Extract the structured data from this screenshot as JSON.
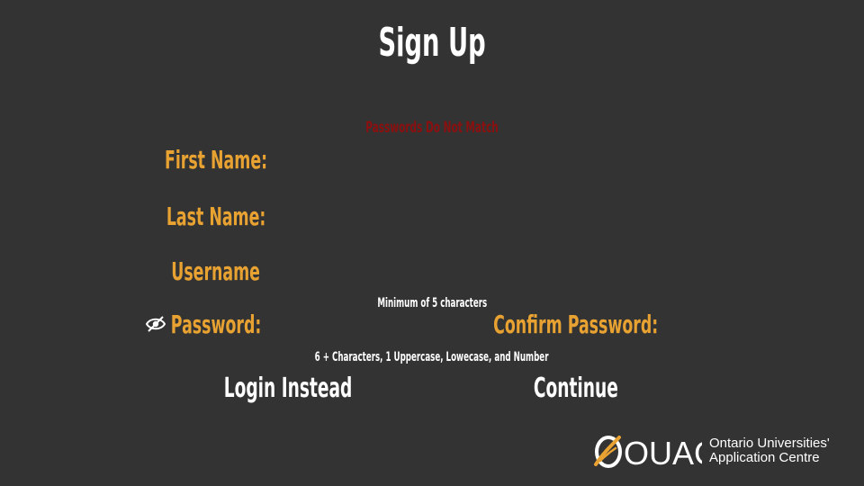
{
  "page": {
    "title": "Sign Up",
    "error": "Passwords Do Not Match"
  },
  "form": {
    "first_name_label": "First Name:",
    "last_name_label": "Last Name:",
    "username_label": "Username",
    "username_hint": "Minimum of 5 characters",
    "password_label": "Password:",
    "confirm_password_label": "Confirm Password:",
    "password_hint": "6 + Characters, 1 Uppercase, Lowecase, and Number",
    "first_name_value": "",
    "last_name_value": "",
    "username_value": "",
    "password_value": "",
    "confirm_password_value": ""
  },
  "actions": {
    "login_label": "Login Instead",
    "continue_label": "Continue"
  },
  "logo": {
    "mark_text": "OUAC",
    "line1": "Ontario Universities'",
    "line2": "Application Centre"
  },
  "icons": {
    "password_toggle": "eye-off-icon"
  },
  "colors": {
    "background": "#333333",
    "label": "#e8a232",
    "error": "#8b1010",
    "text": "#ffffff"
  }
}
